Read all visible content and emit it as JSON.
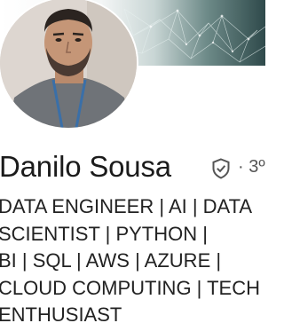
{
  "profile": {
    "name": "Danilo Sousa",
    "connection_degree": "· 3º",
    "verified_icon": "shield-check-icon",
    "headline_lines": [
      "DATA ENGINEER | AI | DATA",
      "SCIENTIST | PYTHON  |",
      "BI | SQL | AWS | AZURE |",
      "CLOUD COMPUTING | TECH",
      "ENTHUSIAST"
    ]
  },
  "colors": {
    "banner_dark": "#2f4a4b",
    "text": "#1b1b1b"
  }
}
